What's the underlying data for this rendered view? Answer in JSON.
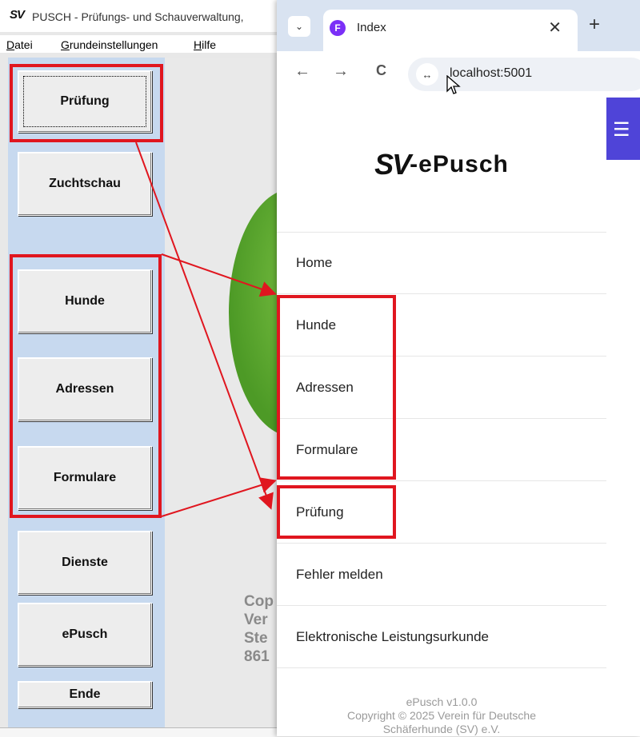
{
  "legacy_app": {
    "title": "PUSCH - Prüfungs- und Schauverwaltung,",
    "logo": "SV",
    "menu": [
      {
        "label": "Datei",
        "underline": "D"
      },
      {
        "label": "Grundeinstellungen",
        "underline": "G"
      },
      {
        "label": "Hilfe",
        "underline": "H"
      }
    ],
    "buttons": {
      "pruefung": "Prüfung",
      "zuchtschau": "Zuchtschau",
      "hunde": "Hunde",
      "adressen": "Adressen",
      "formulare": "Formulare",
      "dienste": "Dienste",
      "epusch": "ePusch",
      "ende": "Ende"
    },
    "background_text": [
      "Cop",
      "Ver",
      "Ste",
      "861"
    ]
  },
  "browser": {
    "tab_title": "Index",
    "tab_close": "✕",
    "new_tab": "+",
    "url": "localhost:5001",
    "nav": {
      "back": "←",
      "forward": "→",
      "reload": "C"
    },
    "site_info_icon": "tune-icon",
    "accent_color": "#4f44d8"
  },
  "web_app": {
    "brand_sv": "SV",
    "brand_rest": "-ePusch",
    "nav_items": [
      "Home",
      "Hunde",
      "Adressen",
      "Formulare",
      "Prüfung",
      "Fehler melden",
      "Elektronische Leistungsurkunde"
    ],
    "footer": {
      "version": "ePusch v1.0.0",
      "copyright_line1": "Copyright © 2025 Verein für Deutsche",
      "copyright_line2": "Schäferhunde (SV) e.V."
    }
  },
  "annotation_color": "#e0161f"
}
